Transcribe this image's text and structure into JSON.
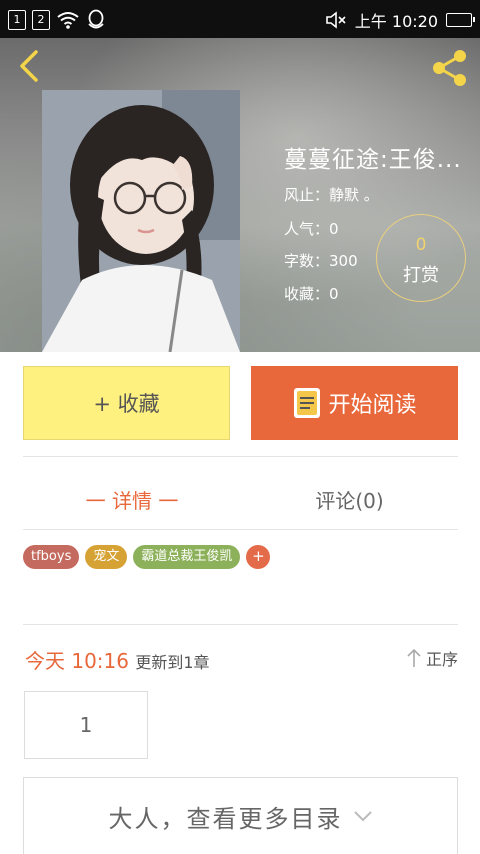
{
  "status_bar": {
    "sim1": "1",
    "sim2": "2",
    "time": "上午 10:20"
  },
  "book": {
    "title": "蔓蔓征途:王俊...",
    "author": "风止：静默 。",
    "popularity": "人气：0",
    "word_count": "字数：300",
    "favorites": "收藏：0",
    "tip_count": "0",
    "tip_label": "打赏"
  },
  "actions": {
    "favorite": "+ 收藏",
    "start_reading": "开始阅读"
  },
  "tabs": {
    "details": "一 详情 一",
    "comments": "评论(0)"
  },
  "tags": [
    {
      "label": "tfboys",
      "color": "#c56a5e"
    },
    {
      "label": "宠文",
      "color": "#d6a233"
    },
    {
      "label": "霸道总裁王俊凯",
      "color": "#8cb15a"
    }
  ],
  "tag_add": "+",
  "updates": {
    "day": "今天",
    "time": "10:16",
    "text": "更新到1章",
    "sort_label": "正序"
  },
  "chapters": [
    "1"
  ],
  "more_catalog": "大人，查看更多目录",
  "colors": {
    "accent": "#e8683c",
    "favorite_bg": "#fff17f",
    "tip_border": "#e9cf7f"
  }
}
